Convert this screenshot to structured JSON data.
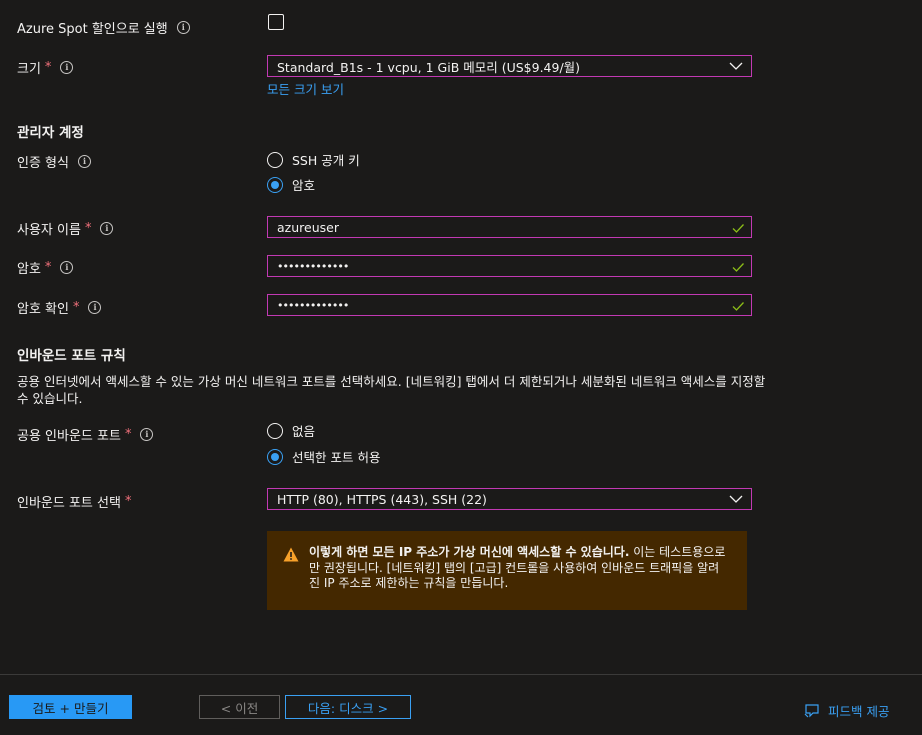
{
  "spot": {
    "label": "Azure Spot 할인으로 실행",
    "checked": false
  },
  "size": {
    "label": "크기",
    "required": "*",
    "value": "Standard_B1s - 1 vcpu, 1 GiB 메모리 (US$9.49/월)",
    "link": "모든 크기 보기"
  },
  "admin": {
    "heading": "관리자 계정",
    "auth_label": "인증 형식",
    "auth_options": [
      "SSH 공개 키",
      "암호"
    ],
    "auth_selected": "암호",
    "username_label": "사용자 이름",
    "username_value": "azureuser",
    "password_label": "암호",
    "password_value": "•••••••••••••",
    "confirm_label": "암호 확인",
    "confirm_value": "•••••••••••••"
  },
  "inbound": {
    "heading": "인바운드 포트 규칙",
    "description": "공용 인터넷에서 액세스할 수 있는 가상 머신 네트워크 포트를 선택하세요. [네트워킹] 탭에서 더 제한되거나 세분화된 네트워크 액세스를 지정할 수 있습니다.",
    "public_label": "공용 인바운드 포트",
    "public_options": [
      "없음",
      "선택한 포트 허용"
    ],
    "public_selected": "선택한 포트 허용",
    "select_label": "인바운드 포트 선택",
    "select_value": "HTTP (80), HTTPS (443), SSH (22)",
    "warning_bold": "이렇게 하면 모든 IP 주소가 가상 머신에 액세스할 수 있습니다.",
    "warning_rest": "이는 테스트용으로만 권장됩니다. [네트워킹] 탭의 [고급] 컨트롤을 사용하여 인바운드 트래픽을 알려진 IP 주소로 제한하는 규칙을 만듭니다."
  },
  "footer": {
    "review_create": "검토 + 만들기",
    "previous": "< 이전",
    "next": "다음: 디스크 >",
    "feedback": "피드백 제공"
  },
  "required_mark": "*",
  "info_glyph": "i",
  "colors": {
    "background": "#1b1a19",
    "accent": "#3aa0f3",
    "field_border": "#c239b3",
    "required": "#f1707b",
    "check": "#8cbd18",
    "warning_bg": "#442800",
    "warning_icon": "#fce100"
  },
  "icons": {
    "chevron": "chevron-down-icon",
    "valid": "checkmark-icon",
    "warning": "warning-icon",
    "feedback": "feedback-icon",
    "info": "info-icon"
  }
}
